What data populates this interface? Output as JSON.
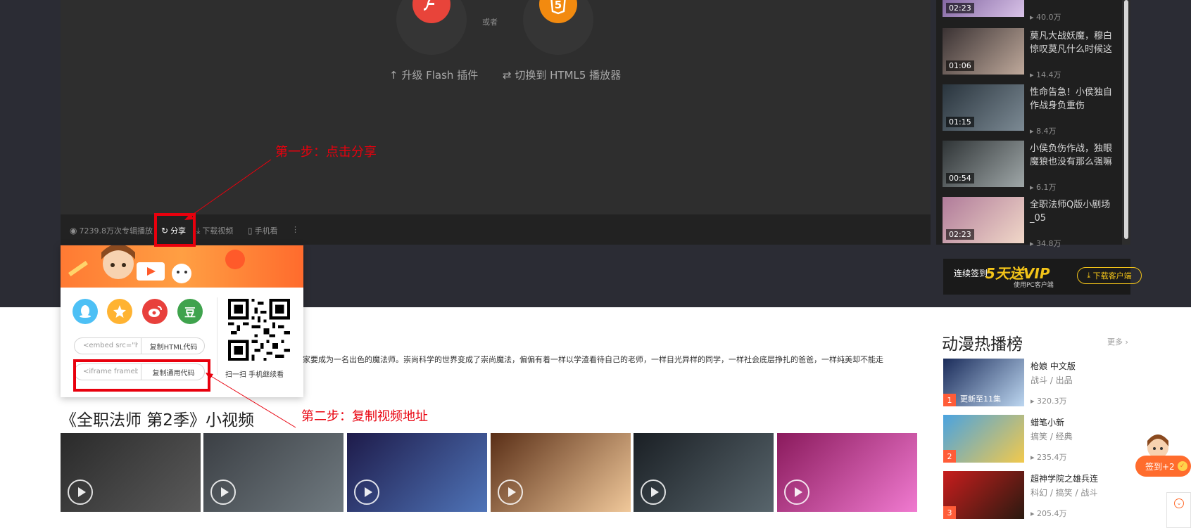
{
  "player": {
    "or_text": "或者",
    "upgrade_flash": "升级 Flash 插件",
    "switch_html5": "切换到 HTML5 播放器",
    "html5_icon_glyph": "5"
  },
  "controls": {
    "plays": "7239.8万次专辑播放",
    "share": "分享",
    "download": "下载视频",
    "mobile": "手机看",
    "more": "⋮"
  },
  "related_list": [
    {
      "duration": "02:23",
      "title": "",
      "plays": "40.0万",
      "colors": [
        "#6b4c8e",
        "#d9c3e8"
      ]
    },
    {
      "duration": "01:06",
      "title": "莫凡大战妖魔，穆白惊叹莫凡什么时候这",
      "plays": "14.4万",
      "colors": [
        "#3a3233",
        "#bfa99b"
      ]
    },
    {
      "duration": "01:15",
      "title": "性命告急！小侯独自作战身负重伤",
      "plays": "8.4万",
      "colors": [
        "#29343d",
        "#7c8a94"
      ]
    },
    {
      "duration": "00:54",
      "title": "小侯负伤作战，独眼魔狼也没有那么强嘛",
      "plays": "6.1万",
      "colors": [
        "#2f3436",
        "#9fa7a8"
      ]
    },
    {
      "duration": "02:23",
      "title": "全职法师Q版小剧场_05",
      "plays": "34.8万",
      "colors": [
        "#b07b9a",
        "#f1d8c8"
      ]
    }
  ],
  "vip_banner": {
    "prefix": "连续签到",
    "highlight": "5天送VIP",
    "sub": "使用PC客户端",
    "button": "下载客户端"
  },
  "share_popup": {
    "html_input": "<embed src=\"h",
    "html_button": "复制HTML代码",
    "iframe_input": "<iframe frameb",
    "iframe_button": "复制通用代码",
    "qr_caption": "扫一扫 手机继续看",
    "douban_glyph": "豆"
  },
  "description": "家要成为一名出色的魔法师。崇尚科学的世界变成了崇尚魔法，偏偏有着一样以学渣看待自己的老师，一样目光异样的同学，一样社会底层挣扎的爸爸，一样纯美却不能走",
  "section_title": "《全职法师 第2季》小视频",
  "short_videos": [
    {
      "colors": [
        "#2a2a2a",
        "#5a5a5a"
      ]
    },
    {
      "colors": [
        "#3b3f44",
        "#707a80"
      ]
    },
    {
      "colors": [
        "#1e1b4a",
        "#4f74b8"
      ]
    },
    {
      "colors": [
        "#5a2f17",
        "#f0c89a"
      ]
    },
    {
      "colors": [
        "#1a1f24",
        "#58656c"
      ]
    },
    {
      "colors": [
        "#8a1a5c",
        "#f07ad0"
      ]
    }
  ],
  "hot": {
    "title": "动漫热播榜",
    "more": "更多",
    "items": [
      {
        "rank": "1",
        "update": "更新至11集",
        "title": "枪娘 中文版",
        "tags": "战斗 / 出品",
        "plays": "320.3万",
        "colors": [
          "#1b2c5a",
          "#bcd6f0"
        ]
      },
      {
        "rank": "2",
        "update": "",
        "title": "蜡笔小新",
        "tags": "搞笑 / 经典",
        "plays": "235.4万",
        "colors": [
          "#4aa3e0",
          "#f2c94c"
        ]
      },
      {
        "rank": "3",
        "update": "",
        "title": "超神学院之雄兵连",
        "tags": "科幻 / 搞笑 / 战斗",
        "plays": "205.4万",
        "colors": [
          "#c81d1d",
          "#2a1a10"
        ]
      }
    ]
  },
  "checkin": {
    "label": "签到+2"
  },
  "annotations": {
    "step1": "第一步：点击分享",
    "step2": "第二步：复制视频地址",
    "color": "#e8000d"
  }
}
